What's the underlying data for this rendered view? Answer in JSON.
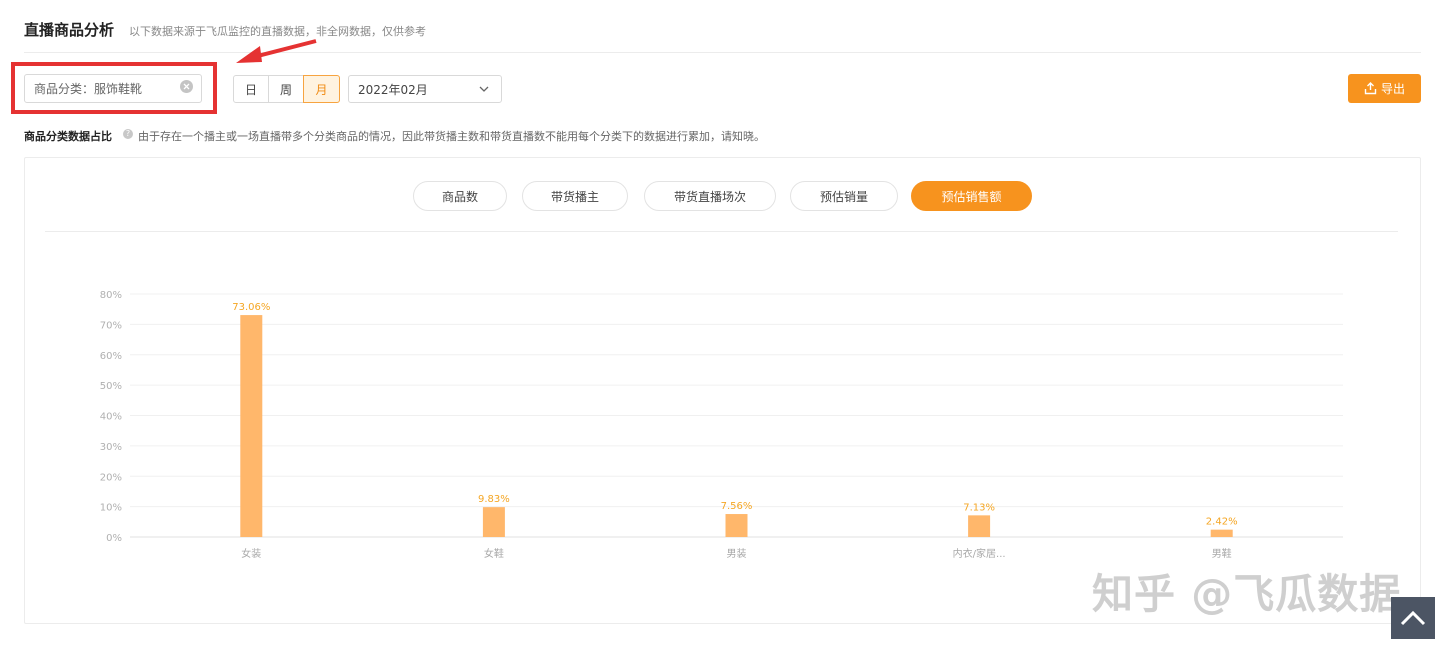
{
  "header": {
    "title": "直播商品分析",
    "subtitle": "以下数据来源于飞瓜监控的直播数据，非全网数据，仅供参考"
  },
  "filters": {
    "category_value": "商品分类：服饰鞋靴",
    "period_options": [
      "日",
      "周",
      "月"
    ],
    "period_selected": "月",
    "date_value": "2022年02月",
    "export_label": "导出"
  },
  "section": {
    "label": "商品分类数据占比",
    "note": "由于存在一个播主或一场直播带多个分类商品的情况，因此带货播主数和带货直播数不能用每个分类下的数据进行累加，请知晓。"
  },
  "metric_tabs": [
    {
      "label": "商品数",
      "active": false
    },
    {
      "label": "带货播主",
      "active": false
    },
    {
      "label": "带货直播场次",
      "active": false
    },
    {
      "label": "预估销量",
      "active": false
    },
    {
      "label": "预估销售额",
      "active": true
    }
  ],
  "chart_data": {
    "type": "bar",
    "categories": [
      "女装",
      "女鞋",
      "男装",
      "内衣/家居...",
      "男鞋"
    ],
    "values": [
      73.06,
      9.83,
      7.56,
      7.13,
      2.42
    ],
    "data_labels": [
      "73.06%",
      "9.83%",
      "7.56%",
      "7.13%",
      "2.42%"
    ],
    "ylim": [
      0,
      80
    ],
    "yticks": [
      "0%",
      "10%",
      "20%",
      "30%",
      "40%",
      "50%",
      "60%",
      "70%",
      "80%"
    ],
    "grid": true,
    "bar_color": "#ffb76b"
  },
  "watermark": "知乎 @飞瓜数据",
  "colors": {
    "accent": "#f7931e",
    "highlight_box": "#e53232"
  }
}
